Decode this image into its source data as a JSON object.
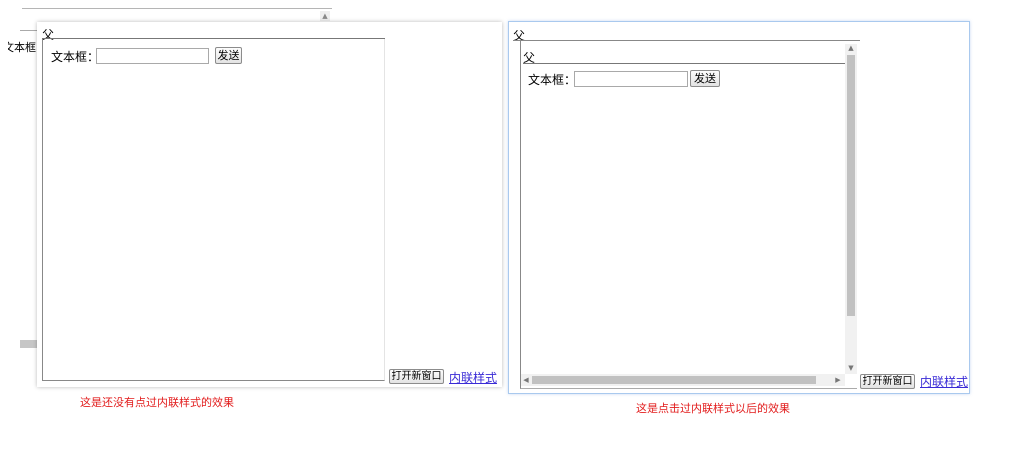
{
  "bg_fragment": {
    "label": "文本框"
  },
  "left_demo": {
    "frame_title": "父",
    "text_label": "文本框：",
    "text_value": "",
    "send_button": "发送",
    "open_window_button": "打开新窗口",
    "inline_style_link": "内联样式",
    "caption": "这是还没有点过内联样式的效果"
  },
  "right_demo": {
    "outer_title": "父",
    "inner_title": "父",
    "text_label": "文本框：",
    "text_value": "",
    "send_button": "发送",
    "open_window_button": "打开新窗口",
    "inline_style_link": "内联样式",
    "caption": "这是点击过内联样式以后的效果"
  },
  "colors": {
    "caption_red": "#e21b1b",
    "link_blue": "#3a2bd6",
    "focus_border": "#a9c9ee"
  }
}
